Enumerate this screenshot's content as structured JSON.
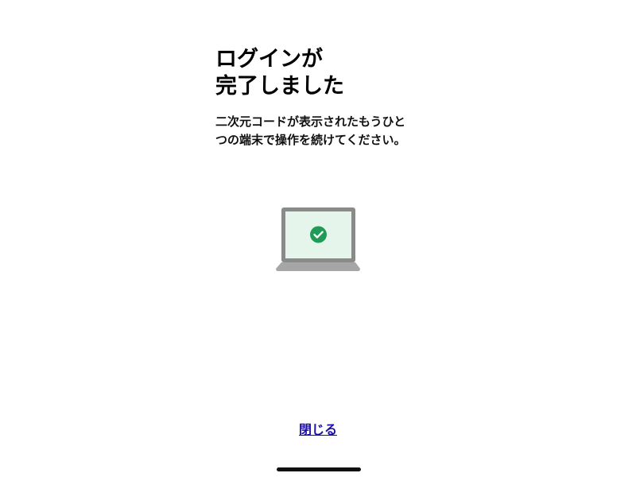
{
  "title": {
    "line1": "ログインが",
    "line2": "完了しました"
  },
  "description": {
    "line1": "二次元コードが表示されたもうひと",
    "line2": "つの端末で操作を続けてください。"
  },
  "illustration": {
    "icon": "laptop-check-icon",
    "screen_color": "#e6f5ec",
    "frame_color": "#8a8a8a",
    "check_color": "#1f9a57"
  },
  "actions": {
    "close_label": "閉じる"
  }
}
